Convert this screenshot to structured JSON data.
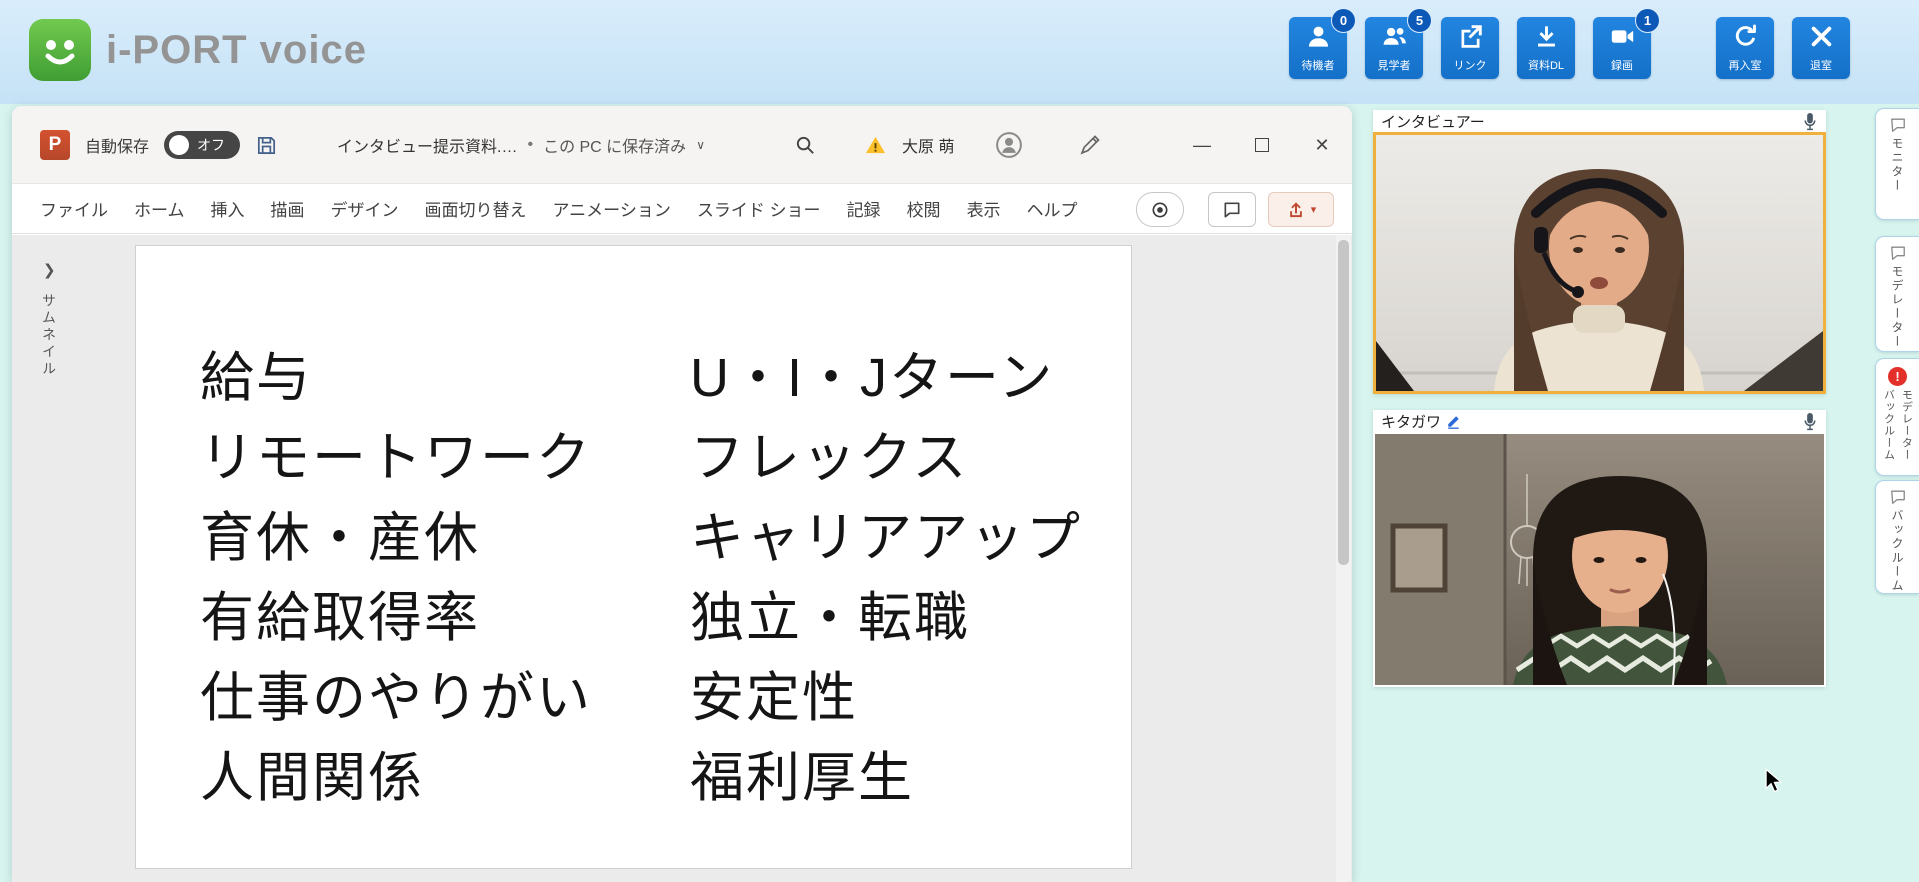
{
  "header": {
    "logo_text": "i-PORT voice",
    "buttons": [
      {
        "label": "待機者",
        "badge": "0",
        "icon": "person-icon"
      },
      {
        "label": "見学者",
        "badge": "5",
        "icon": "people-icon"
      },
      {
        "label": "リンク",
        "icon": "external-link-icon"
      },
      {
        "label": "資料DL",
        "icon": "download-icon"
      },
      {
        "label": "録画",
        "badge": "1",
        "icon": "video-camera-icon"
      },
      {
        "label": "再入室",
        "icon": "reenter-icon"
      },
      {
        "label": "退室",
        "icon": "exit-icon"
      }
    ]
  },
  "ppt": {
    "titlebar": {
      "app_letter": "P",
      "autosave_label": "自動保存",
      "autosave_state": "オフ",
      "doc_title": "インタビュー提示資料.…",
      "separator": "•",
      "saved_status": "この PC に保存済み",
      "user_name": "大原 萌"
    },
    "menu": [
      "ファイル",
      "ホーム",
      "挿入",
      "描画",
      "デザイン",
      "画面切り替え",
      "アニメーション",
      "スライド ショー",
      "記録",
      "校閲",
      "表示",
      "ヘルプ"
    ],
    "thumbnail_label": "サムネイル",
    "slide": {
      "left_column": [
        "給与",
        "リモートワーク",
        "育休・産休",
        "有給取得率",
        "仕事のやりがい",
        "人間関係"
      ],
      "right_column": [
        "U・I・Jターン",
        "フレックス",
        "キャリアアップ",
        "独立・転職",
        "安定性",
        "福利厚生"
      ]
    }
  },
  "videos": [
    {
      "label": "インタビュアー",
      "highlighted": true
    },
    {
      "label": "キタガワ",
      "editable": true
    }
  ],
  "side_tabs": {
    "monitor": "モニター",
    "moderator": "モデレーター",
    "mod_back_a": "モデレーター",
    "mod_back_b": "バックルーム",
    "alert": "!",
    "backroom": "バックルーム"
  },
  "icons": {
    "chevron_right": "❯",
    "dropdown": "∨",
    "caret_down": "▾",
    "minimize": "—",
    "close": "✕"
  },
  "colors": {
    "header_bg": "#cde6f7",
    "main_bg": "#d8f4ee",
    "button_blue": "#1777d2",
    "badge_blue": "#0d59b8",
    "highlight_orange": "#efb13c",
    "ppt_accent": "#b7472a",
    "alert_red": "#e4302a"
  }
}
